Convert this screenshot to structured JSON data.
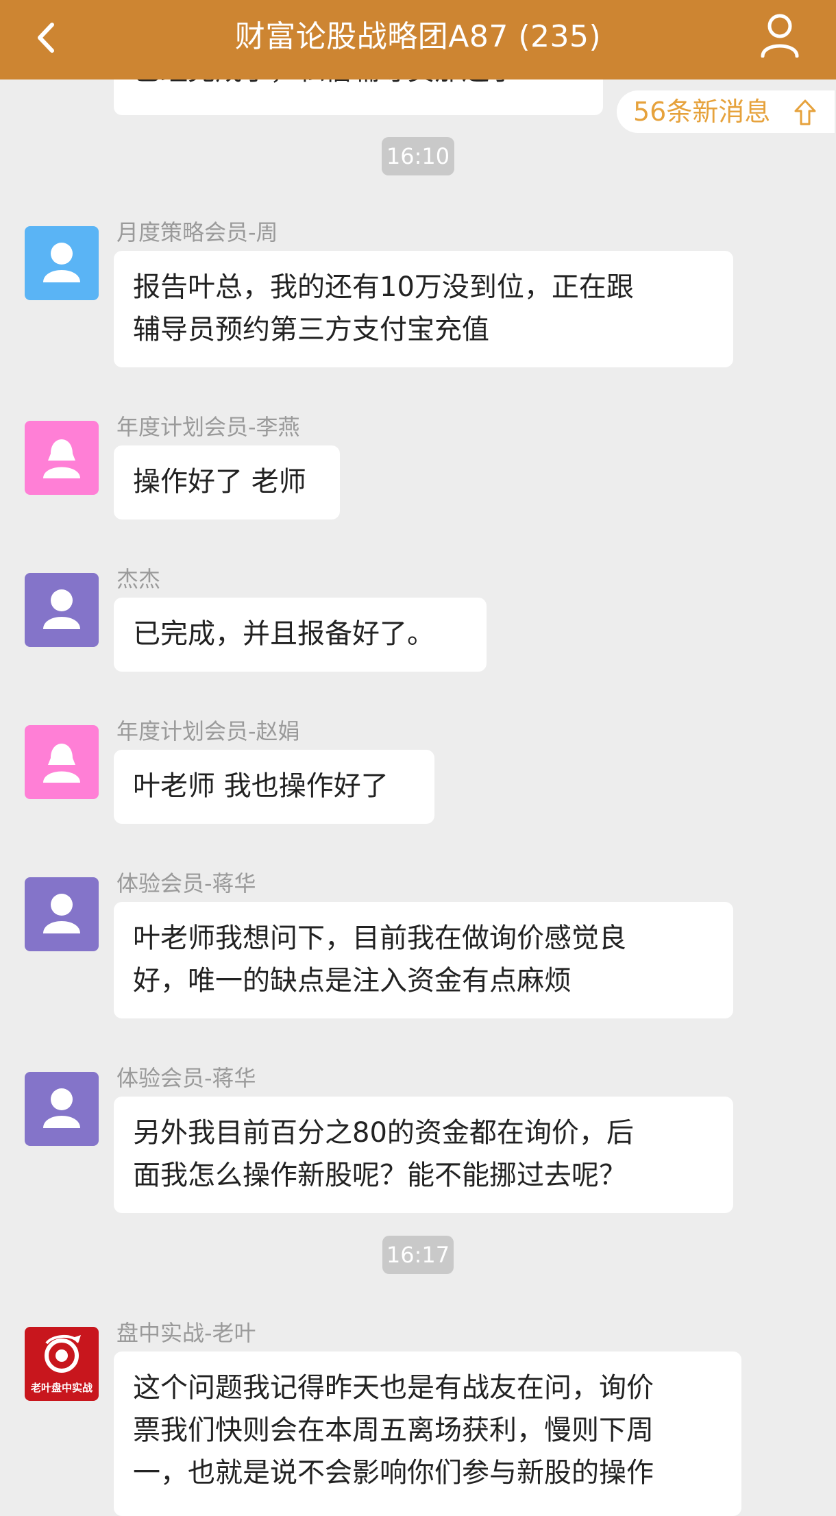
{
  "header": {
    "title": "财富论股战略团A87 (235)",
    "back_icon": "chevron-left-icon",
    "profile_icon": "user-icon",
    "background": "#cd8532"
  },
  "partial_top_message": "已经完成了，私信辅导员那边了",
  "new_messages": {
    "label": "56条新消息",
    "icon": "arrow-up-icon",
    "color": "#e6a23c"
  },
  "times": [
    "16:10",
    "16:17"
  ],
  "messages": [
    {
      "sender": "月度策略会员-周",
      "avatar": "user-icon",
      "avatar_color": "#5ab4f5",
      "lines": [
        "报告叶总，我的还有10万没到位，正在跟",
        "辅导员预约第三方支付宝充值"
      ]
    },
    {
      "sender": "年度计划会员-李燕",
      "avatar": "female-user-icon",
      "avatar_color": "#ff7fd6",
      "lines": [
        "操作好了 老师"
      ]
    },
    {
      "sender": "杰杰",
      "avatar": "user-icon",
      "avatar_color": "#8474c9",
      "lines": [
        "已完成，并且报备好了。"
      ]
    },
    {
      "sender": "年度计划会员-赵娟",
      "avatar": "female-user-icon",
      "avatar_color": "#ff7fd6",
      "lines": [
        "叶老师 我也操作好了"
      ]
    },
    {
      "sender": "体验会员-蒋华",
      "avatar": "user-icon",
      "avatar_color": "#8474c9",
      "lines": [
        "叶老师我想问下，目前我在做询价感觉良",
        "好，唯一的缺点是注入资金有点麻烦"
      ]
    },
    {
      "sender": "体验会员-蒋华",
      "avatar": "user-icon",
      "avatar_color": "#8474c9",
      "lines": [
        "另外我目前百分之80的资金都在询价，后",
        "面我怎么操作新股呢？能不能挪过去呢？"
      ]
    },
    {
      "sender": "盘中实战-老叶",
      "avatar": "dragon-logo-icon",
      "avatar_color": "#c8161d",
      "avatar_text": "老叶盘中实战",
      "lines": [
        "这个问题我记得昨天也是有战友在问，询价",
        "票我们快则会在本周五离场获利，慢则下周",
        "一，也就是说不会影响你们参与新股的操作"
      ]
    }
  ]
}
